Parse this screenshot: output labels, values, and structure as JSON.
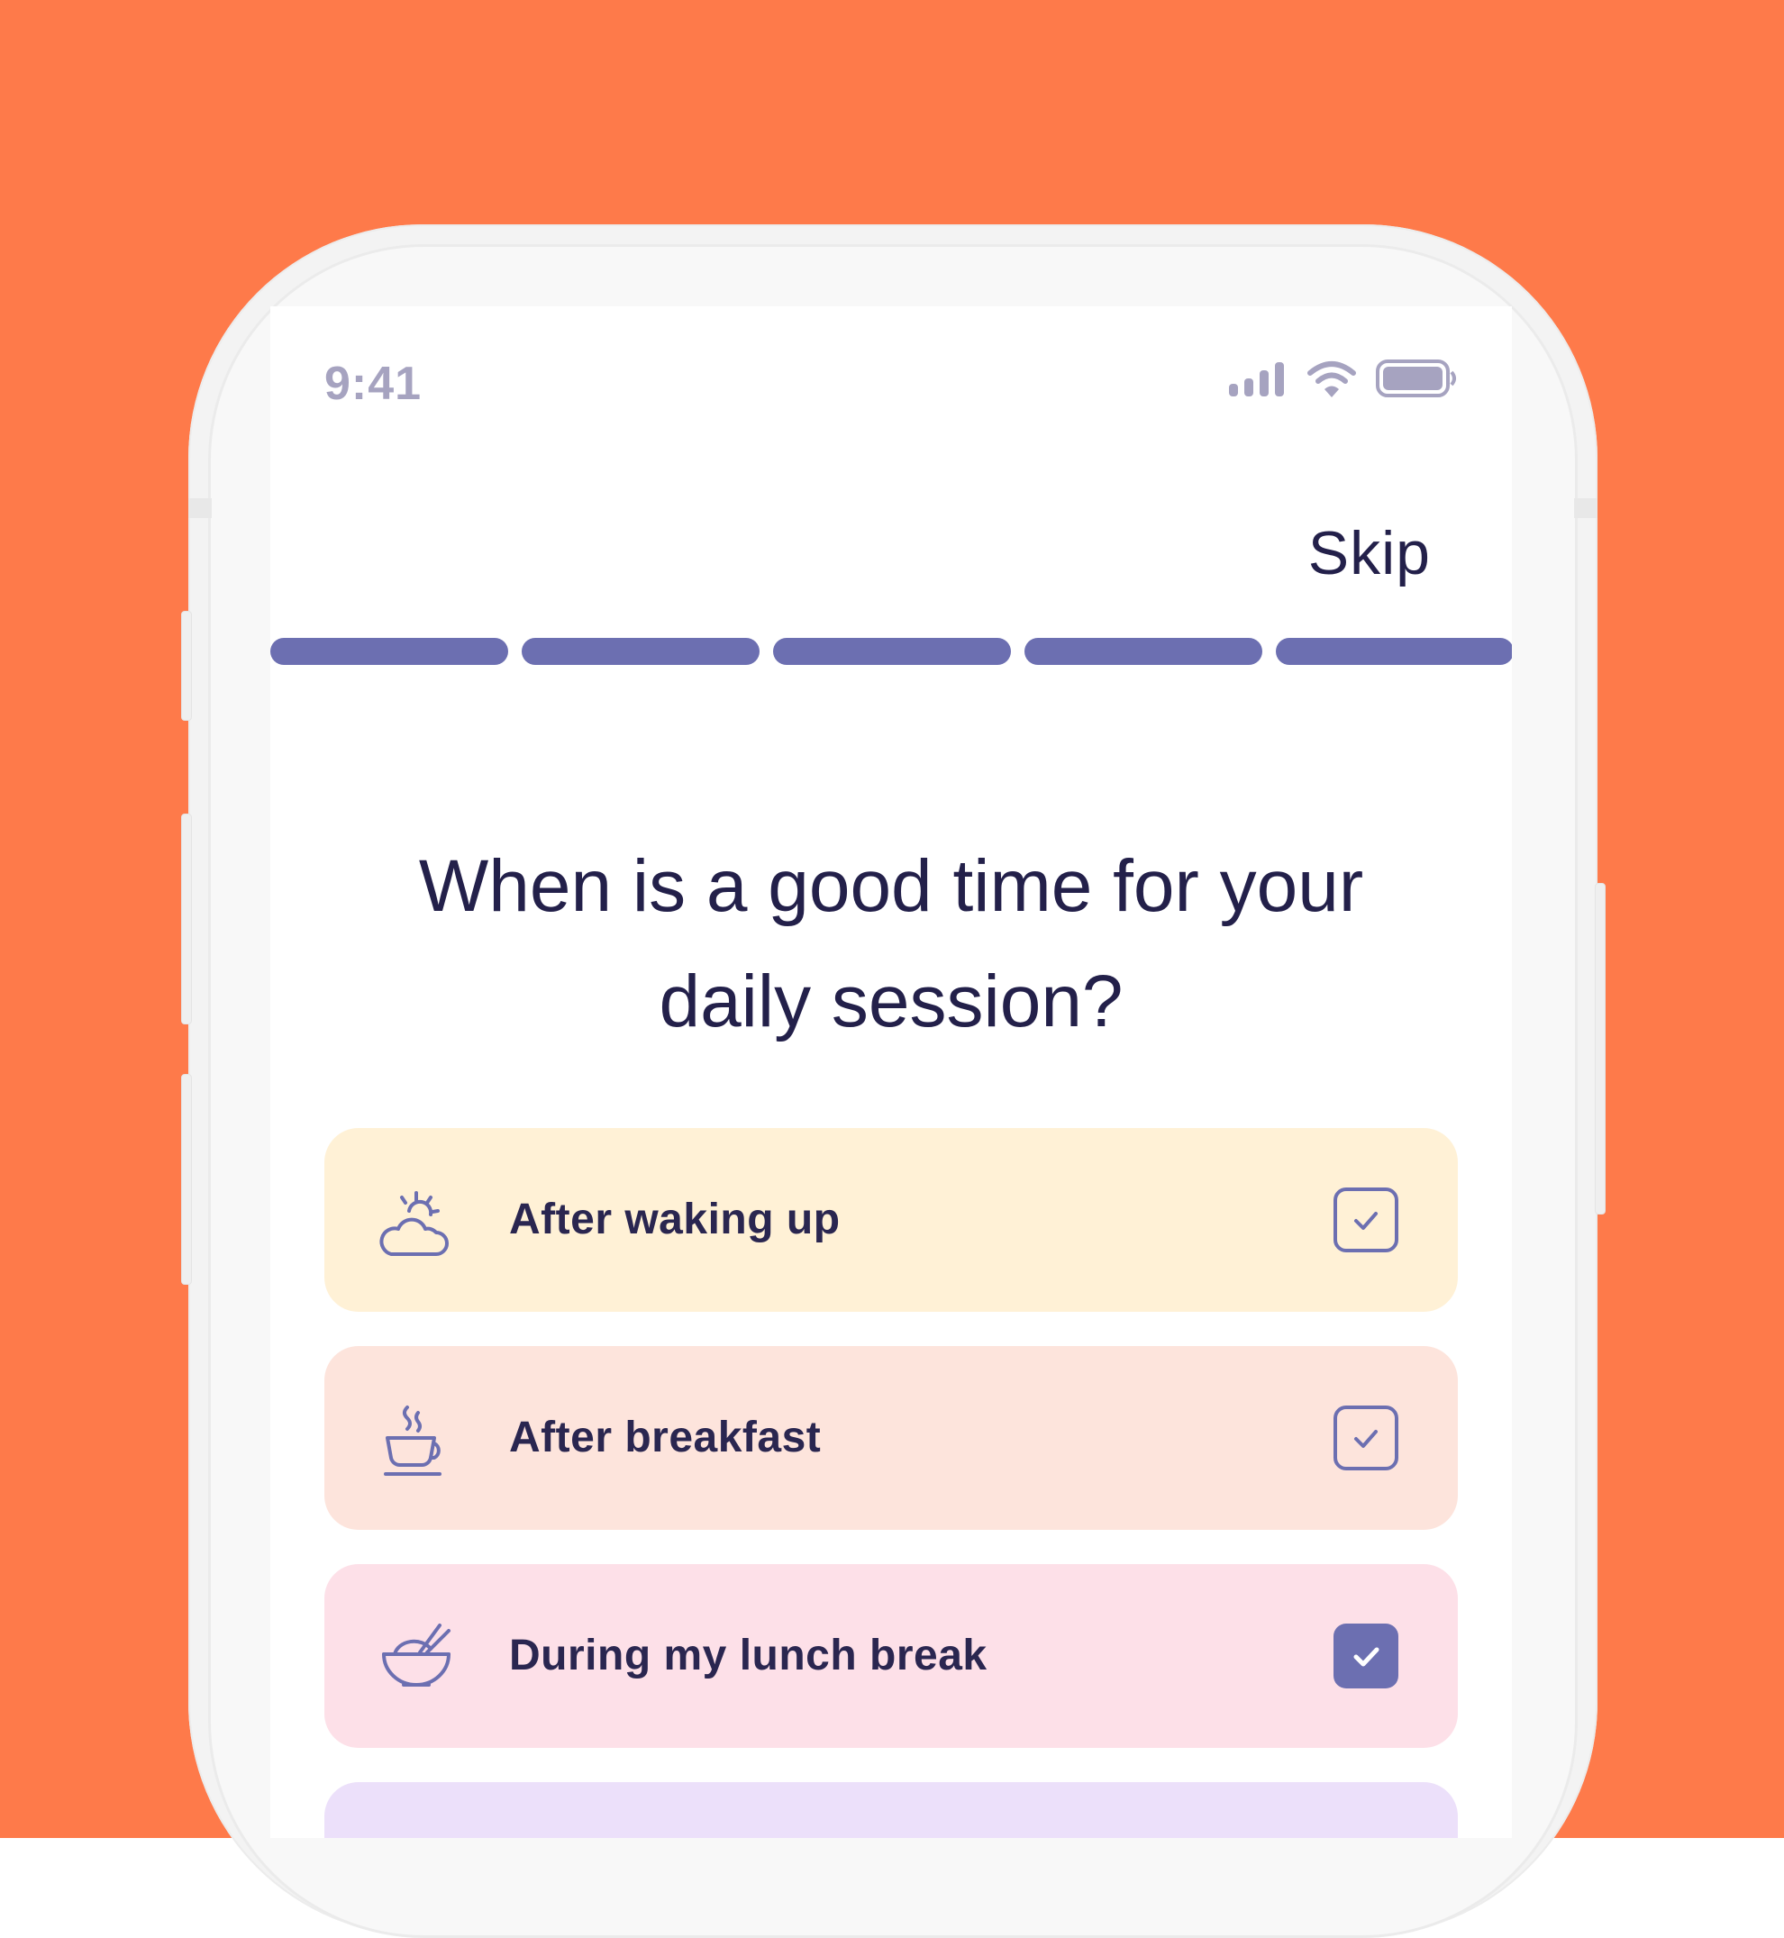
{
  "colors": {
    "background": "#fe7a4a",
    "accent": "#6c6fb1",
    "text": "#23204a",
    "status_gray": "#a6a3c0"
  },
  "status_bar": {
    "time": "9:41",
    "icons": [
      "signal-icon",
      "wifi-icon",
      "battery-icon"
    ]
  },
  "header": {
    "skip_label": "Skip"
  },
  "progress": {
    "segments": 5,
    "completed": 5
  },
  "question": {
    "line1": "When is a good time for your",
    "line2": "daily session?"
  },
  "options": [
    {
      "label": "After waking up",
      "icon": "sunrise-cloud-icon",
      "checked": false,
      "color": "#fff1d6"
    },
    {
      "label": "After breakfast",
      "icon": "coffee-cup-icon",
      "checked": false,
      "color": "#fde4dc"
    },
    {
      "label": "During my lunch break",
      "icon": "bowl-chopsticks-icon",
      "checked": true,
      "color": "#fde0e8"
    },
    {
      "label": "",
      "icon": "",
      "checked": false,
      "color": "#ece0fa"
    }
  ]
}
